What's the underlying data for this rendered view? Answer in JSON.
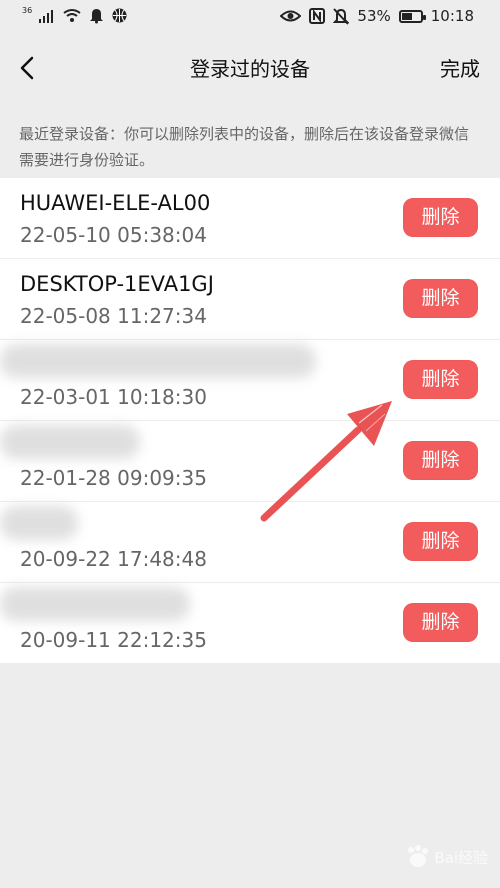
{
  "status_bar": {
    "signal_label": "36",
    "battery_percent": "53%",
    "time": "10:18",
    "battery_level": 0.53
  },
  "nav": {
    "back_icon": "chevron-left-icon",
    "title": "登录过的设备",
    "done_label": "完成"
  },
  "notice": {
    "text": "最近登录设备：你可以删除列表中的设备，删除后在该设备登录微信需要进行身份验证。"
  },
  "devices": [
    {
      "name": "HUAWEI-ELE-AL00",
      "time": "22-05-10 05:38:04",
      "delete_label": "删除"
    },
    {
      "name": "DESKTOP-1EVA1GJ",
      "time": "22-05-08 11:27:34",
      "delete_label": "删除"
    },
    {
      "name": "",
      "time": "22-03-01 10:18:30",
      "delete_label": "删除"
    },
    {
      "name": "",
      "time": "22-01-28 09:09:35",
      "delete_label": "删除"
    },
    {
      "name": "",
      "time": "20-09-22 17:48:48",
      "delete_label": "删除"
    },
    {
      "name": "",
      "time": "20-09-11 22:12:35",
      "delete_label": "删除"
    }
  ],
  "watermark": {
    "text": "Bai经验"
  },
  "colors": {
    "background": "#ededed",
    "delete_button": "#f25c5c",
    "arrow": "#e94a4a"
  }
}
